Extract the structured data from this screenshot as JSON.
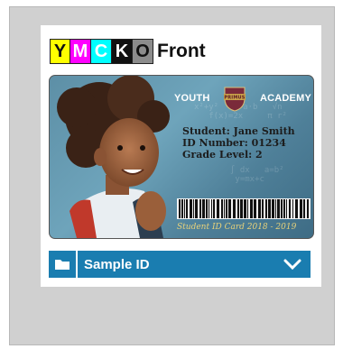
{
  "channels": [
    {
      "label": "Y",
      "bg": "#ffff00",
      "fg": "#111111"
    },
    {
      "label": "M",
      "bg": "#ff00ff",
      "fg": "#ffffff"
    },
    {
      "label": "C",
      "bg": "#00ffff",
      "fg": "#ffffff"
    },
    {
      "label": "K",
      "bg": "#111111",
      "fg": "#ffffff"
    },
    {
      "label": "O",
      "bg": "#8c8c8c",
      "fg": "#111111"
    }
  ],
  "side_title": "Front",
  "card": {
    "school_left": "YOUTH",
    "school_right": "ACADEMY",
    "crest_text": "PRIMUS",
    "student_line": "Student: Jane Smith",
    "id_line": "ID Number: 01234",
    "grade_line": "Grade Level: 2",
    "footer": "Student ID Card 2018 - 2019"
  },
  "template_select": {
    "selected": "Sample ID",
    "icon": "folder-icon",
    "expand_icon": "chevron-down-icon"
  },
  "colors": {
    "accent": "#1a7db0",
    "frame": "#d0d0d0"
  }
}
